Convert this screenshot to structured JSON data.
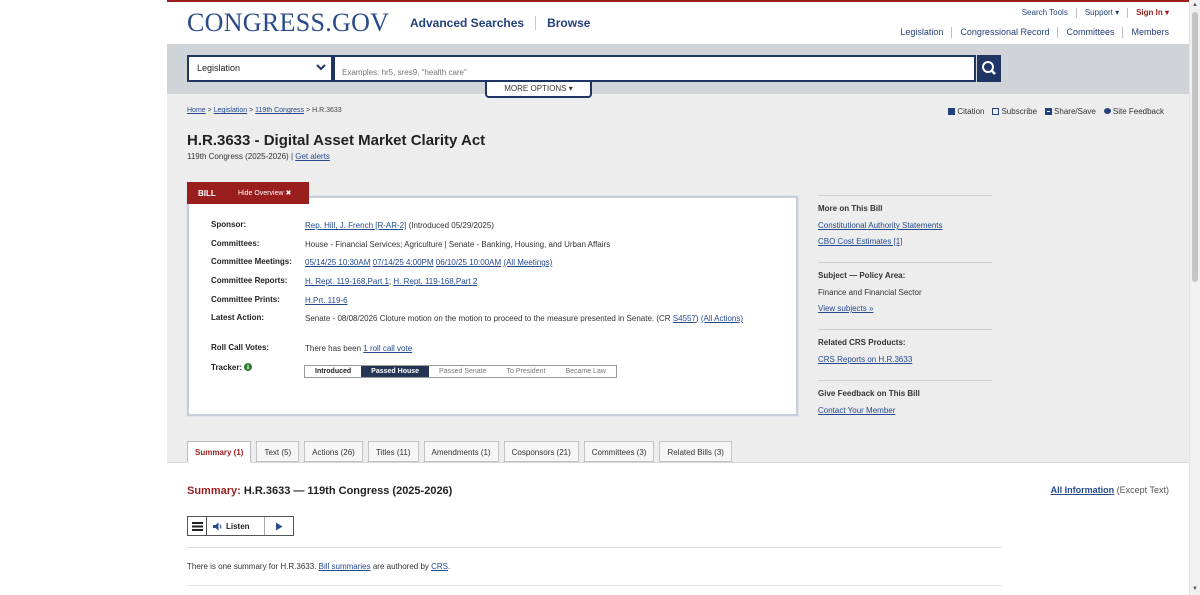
{
  "header": {
    "logo": "CONGRESS.GOV",
    "main_nav": [
      "Advanced Searches",
      "Browse"
    ],
    "util_nav": [
      "Search Tools",
      "Support ▾",
      "Sign In ▾"
    ],
    "sec_nav": [
      "Legislation",
      "Congressional Record",
      "Committees",
      "Members"
    ]
  },
  "search": {
    "collection": "Legislation",
    "placeholder": "Examples: hr5, sres9, \"health care\"",
    "more_options": "MORE OPTIONS ▾"
  },
  "breadcrumb": {
    "home": "Home",
    "legislation": "Legislation",
    "congress": "119th Congress",
    "current": "H.R.3633",
    "sep": ">"
  },
  "tools": [
    "Citation",
    "Subscribe",
    "Share/Save",
    "Site Feedback"
  ],
  "bill": {
    "title": "H.R.3633 - Digital Asset Market Clarity Act",
    "congress": "119th Congress (2025-2026)",
    "get_alerts": "Get alerts",
    "sep": "|"
  },
  "overview": {
    "tab_label": "BILL",
    "hide_label": "Hide Overview ✖",
    "sponsor_label": "Sponsor:",
    "sponsor_link": "Rep. Hill, J. French [R-AR-2]",
    "sponsor_extra": " (Introduced 05/29/2025)",
    "committees_label": "Committees:",
    "committees": "House - Financial Services; Agriculture | Senate - Banking, Housing, and Urban Affairs",
    "meetings_label": "Committee Meetings:",
    "meetings": [
      "05/14/25 10:30AM",
      "07/14/25 4:00PM",
      "06/10/25 10:00AM",
      "(All Meetings)"
    ],
    "reports_label": "Committee Reports:",
    "reports": [
      "H. Rept. 119-168,Part 1",
      "H. Rept. 119-168,Part 2"
    ],
    "reports_sep": ";",
    "prints_label": "Committee Prints:",
    "prints": "H.Prt. 119-6",
    "action_label": "Latest Action:",
    "action_text": "Senate - 08/08/2026 Cloture motion on the motion to proceed to the measure presented in Senate. (CR ",
    "action_cr": "S4557",
    "action_close": ") ",
    "action_all": "(All Actions)",
    "votes_label": "Roll Call Votes:",
    "votes_text": "There has been ",
    "votes_link": "1 roll call vote",
    "tracker_label": "Tracker:",
    "tracker_steps": [
      "Introduced",
      "Passed House",
      "Passed Senate",
      "To President",
      "Became Law"
    ],
    "tracker_current": 1
  },
  "rail": {
    "more_title": "More on This Bill",
    "more_links": [
      "Constitutional Authority Statements",
      "CBO Cost Estimates [1]"
    ],
    "subject_title": "Subject — Policy Area:",
    "subject_value": "Finance and Financial Sector",
    "subject_link": "View subjects »",
    "crs_title": "Related CRS Products:",
    "crs_link": "CRS Reports on H.R.3633",
    "feedback_title": "Give Feedback on This Bill",
    "feedback_link": "Contact Your Member"
  },
  "tabs": [
    "Summary (1)",
    "Text (5)",
    "Actions (26)",
    "Titles (11)",
    "Amendments (1)",
    "Cosponsors (21)",
    "Committees (3)",
    "Related Bills (3)"
  ],
  "summary": {
    "head_red": "Summary:",
    "head_rest": " H.R.3633 — 119th Congress (2025-2026)",
    "all_info": "All Information",
    "except": " (Except Text)",
    "listen": "Listen",
    "note_a": "There is one summary for H.R.3633. ",
    "note_link1": "Bill summaries",
    "note_b": " are authored by ",
    "note_link2": "CRS",
    "note_c": "."
  },
  "colors": {
    "brand_blue": "#2a4a8a",
    "brand_red": "#9a1e1e",
    "navy": "#1f3565"
  }
}
